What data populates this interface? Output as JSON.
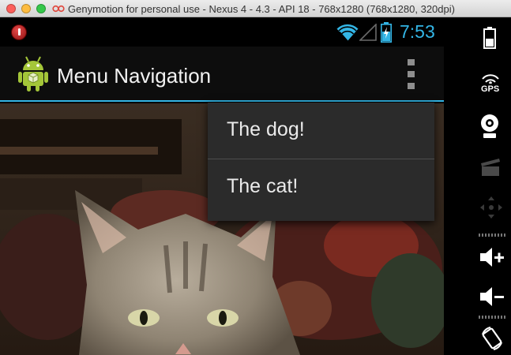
{
  "window": {
    "title": "Genymotion for personal use - Nexus 4 - 4.3 - API 18 - 768x1280 (768x1280, 320dpi)"
  },
  "status_bar": {
    "time": "7:53",
    "icons": [
      "notification-icon",
      "wifi-icon",
      "signal-icon",
      "battery-charging-icon"
    ],
    "time_color": "#33b5e5"
  },
  "action_bar": {
    "title": "Menu Navigation",
    "app_icon": "android-robot-icon",
    "overflow_icon": "overflow-menu-icon",
    "accent_color": "#33b5e5"
  },
  "popup_menu": {
    "items": [
      {
        "label": "The dog!"
      },
      {
        "label": "The cat!"
      }
    ]
  },
  "content": {
    "image": "cat-photo"
  },
  "sidebar": {
    "buttons": [
      {
        "icon": "battery-icon"
      },
      {
        "icon": "gps-icon",
        "label": "GPS"
      },
      {
        "icon": "webcam-icon"
      },
      {
        "icon": "clapperboard-icon"
      },
      {
        "icon": "dpad-icon"
      },
      {
        "icon": "volume-up-icon"
      },
      {
        "icon": "volume-down-icon"
      },
      {
        "icon": "rotate-icon"
      }
    ]
  }
}
